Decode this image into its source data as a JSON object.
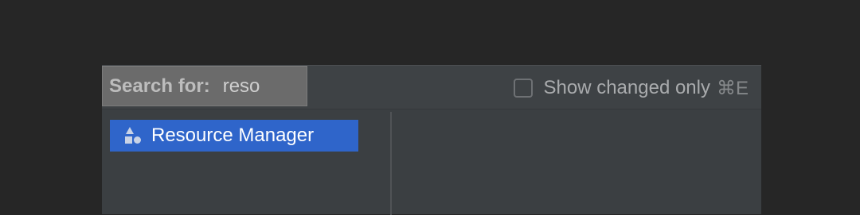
{
  "search": {
    "label": "Search for:",
    "query": "reso"
  },
  "filter": {
    "label": "Show changed only",
    "shortcut": "⌘E",
    "checked": false
  },
  "results": {
    "items": [
      {
        "label": "Resource Manager",
        "icon": "resource-manager-icon",
        "selected": true
      }
    ]
  },
  "colors": {
    "selection": "#2f65ca",
    "background": "#262626",
    "panel": "#3b3f42"
  }
}
